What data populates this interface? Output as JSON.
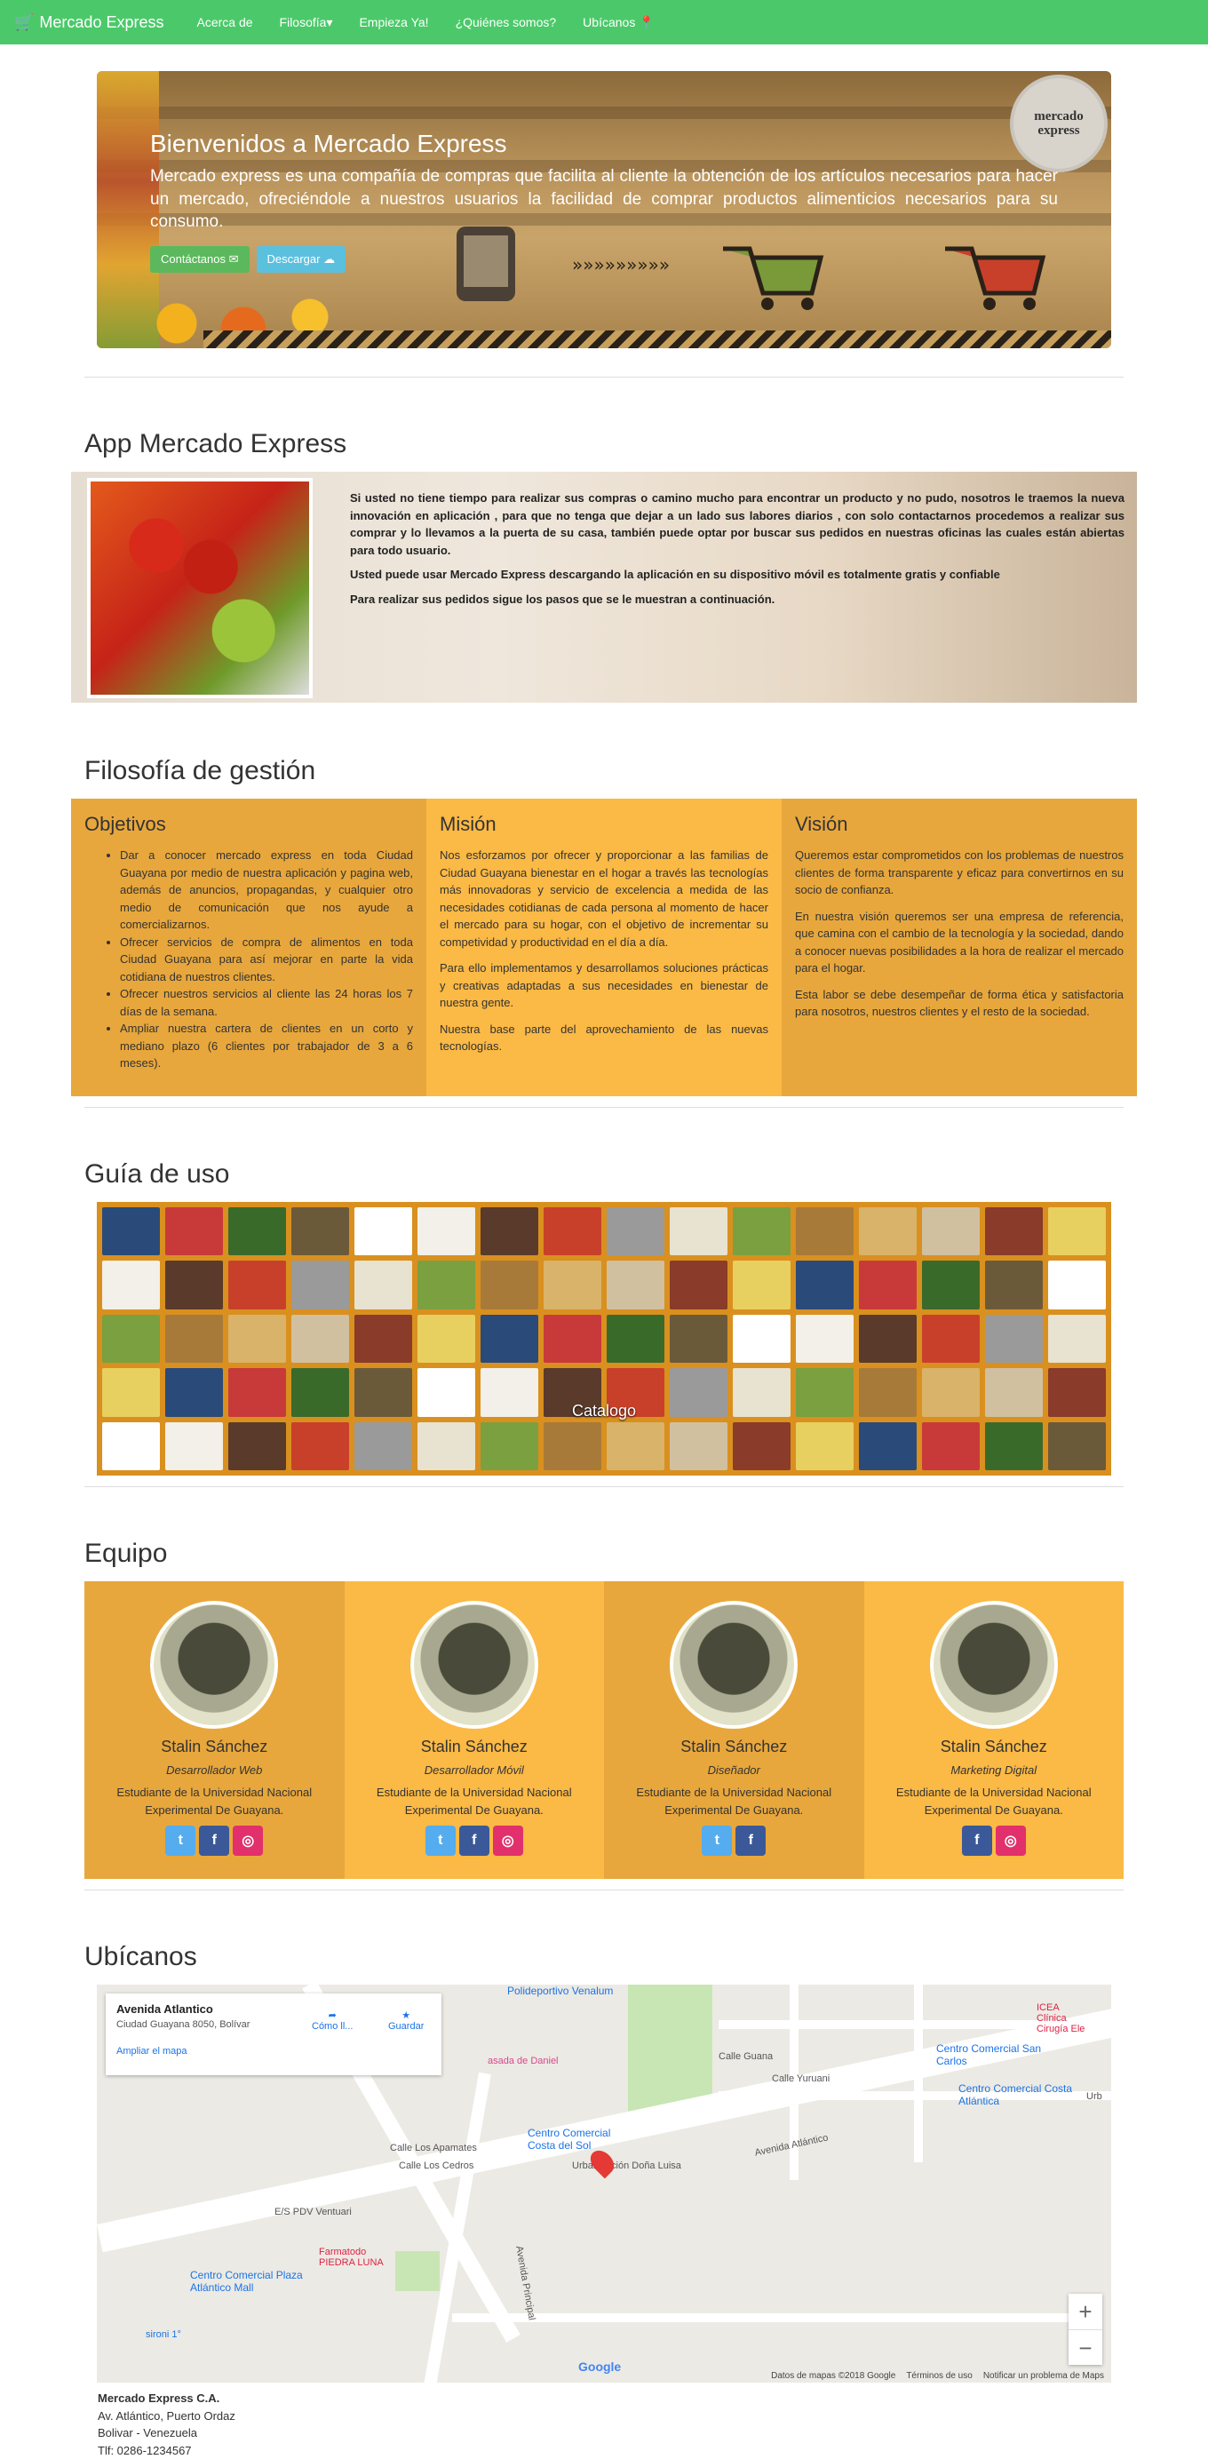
{
  "nav": {
    "brand": "Mercado Express",
    "items": [
      "Acerca de",
      "Filosofía▾",
      "Empieza Ya!",
      "¿Quiénes somos?",
      "Ubícanos"
    ]
  },
  "hero": {
    "title": "Bienvenidos a Mercado Express",
    "text": "Mercado express es una compañía de compras que facilita al cliente la obtención de los artículos necesarios para hacer un mercado, ofreciéndole a nuestros usuarios la facilidad de comprar productos alimenticios necesarios para su consumo.",
    "btn_contact": "Contáctanos ✉",
    "btn_download": "Descargar ☁",
    "logo_line1": "mercado",
    "logo_line2": "express"
  },
  "app": {
    "title": "App Mercado Express",
    "p1": "Si usted no tiene tiempo para realizar sus compras o camino mucho para encontrar un producto y no pudo, nosotros le traemos la nueva innovación en aplicación , para que no tenga que dejar a un lado sus labores diarios , con solo contactarnos procedemos a realizar sus comprar y lo llevamos a la puerta de su casa, también puede optar por buscar sus pedidos en nuestras oficinas las cuales están abiertas para todo usuario.",
    "p2": "Usted puede usar Mercado Express descargando la aplicación en su dispositivo móvil es totalmente gratis y confiable",
    "p3": "Para realizar sus pedidos sigue los pasos que se le muestran a continuación."
  },
  "filosofia": {
    "title": "Filosofía de gestión",
    "objetivos": {
      "title": "Objetivos",
      "items": [
        "Dar a conocer mercado express en toda Ciudad Guayana por medio de nuestra aplicación y pagina web, además de anuncios, propagandas, y cualquier otro medio de comunicación que nos ayude a comercializarnos.",
        "Ofrecer servicios de compra de alimentos en toda Ciudad Guayana para así mejorar en parte la vida cotidiana de nuestros clientes.",
        "Ofrecer nuestros servicios al cliente las 24 horas los 7 días de la semana.",
        "Ampliar nuestra cartera de clientes en un corto y mediano plazo (6 clientes por trabajador de 3 a 6 meses)."
      ]
    },
    "mision": {
      "title": "Misión",
      "p1": "Nos esforzamos por ofrecer y proporcionar a las familias de Ciudad Guayana bienestar en el hogar a través las tecnologías más innovadoras y servicio de excelencia a medida de las necesidades cotidianas de cada persona al momento de hacer el mercado para su hogar, con el objetivo de incrementar su competividad y productividad en el día a día.",
      "p2": "Para ello implementamos y desarrollamos soluciones prácticas y creativas adaptadas a sus necesidades en bienestar de nuestra gente.",
      "p3": "Nuestra base parte del aprovechamiento de las nuevas tecnologías."
    },
    "vision": {
      "title": "Visión",
      "p1": "Queremos estar comprometidos con los problemas de nuestros clientes de forma transparente y eficaz para convertirnos en su socio de confianza.",
      "p2": "En nuestra visión queremos ser una empresa de referencia, que camina con el cambio de la tecnología y la sociedad, dando a conocer nuevas posibilidades a la hora de realizar el mercado para el hogar.",
      "p3": "Esta labor se debe desempeñar de forma ética y satisfactoria para nosotros, nuestros clientes y el resto de la sociedad."
    },
    "colors": [
      "#e8a73c",
      "#fbb945",
      "#e8a73c"
    ]
  },
  "guia": {
    "title": "Guía de uso",
    "caption": "Catalogo"
  },
  "equipo": {
    "title": "Equipo",
    "members": [
      {
        "name": "Stalin Sánchez",
        "role": "Desarrollador Web",
        "desc": "Estudiante de la Universidad Nacional Experimental De Guayana.",
        "socials": [
          "t",
          "f",
          "ig"
        ]
      },
      {
        "name": "Stalin Sánchez",
        "role": "Desarrollador Móvil",
        "desc": "Estudiante de la Universidad Nacional Experimental De Guayana.",
        "socials": [
          "t",
          "f",
          "ig"
        ]
      },
      {
        "name": "Stalin Sánchez",
        "role": "Diseñador",
        "desc": "Estudiante de la Universidad Nacional Experimental De Guayana.",
        "socials": [
          "t",
          "f"
        ]
      },
      {
        "name": "Stalin Sánchez",
        "role": "Marketing Digital",
        "desc": "Estudiante de la Universidad Nacional Experimental De Guayana.",
        "socials": [
          "f",
          "ig"
        ]
      }
    ]
  },
  "ubicanos": {
    "title": "Ubícanos",
    "card_title": "Avenida Atlantico",
    "card_address": "Ciudad Guayana 8050, Bolívar",
    "card_link": "Ampliar el mapa",
    "how": "Cómo ll...",
    "save": "Guardar",
    "labels": {
      "poli": "Polideportivo Venalum",
      "cc_costa": "Centro Comercial Costa del Sol",
      "urb": "Urbanización Doña Luisa",
      "av_atl": "Avenida Atlántico",
      "cc_san": "Centro Comercial San Carlos",
      "cc_costa_atl": "Centro Comercial Costa Atlántica",
      "es_pdv": "E/S PDV Ventuari",
      "farm": "Farmatodo PIEDRA LUNA",
      "cc_plaza": "Centro Comercial Plaza Atlántico Mall",
      "daniel": "asada de Daniel",
      "icea": "ICEA Clínica Cirugía Ele",
      "guana": "Calle Guana",
      "yuruani": "Calle Yuruani",
      "apamates": "Calle Los Apamates",
      "cedros": "Calle Los Cedros",
      "av_prin": "Avenida Principal",
      "urb_short": "Urb",
      "rioni": "sironi 1°"
    },
    "map_footer": [
      "Datos de mapas ©2018 Google",
      "Términos de uso",
      "Notificar un problema de Maps"
    ],
    "google": "Google",
    "zoom_in": "+",
    "zoom_out": "−"
  },
  "contact": {
    "company": "Mercado Express C.A.",
    "line1": "Av. Atlántico, Puerto Ordaz",
    "line2": "Bolivar - Venezuela",
    "phone": "Tlf: 0286-1234567"
  }
}
